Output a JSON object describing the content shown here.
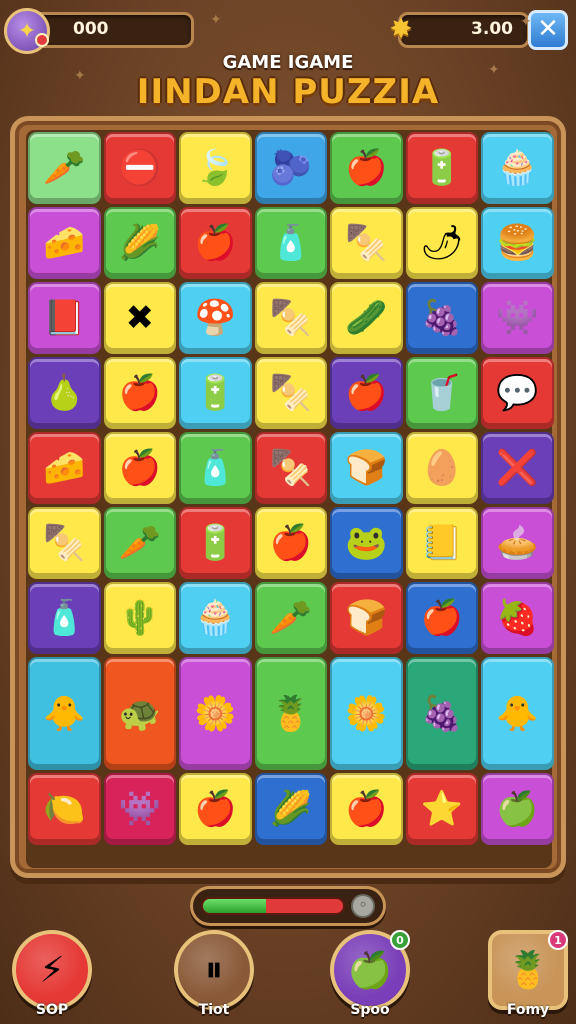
{
  "hud": {
    "score": "000",
    "coins": "3.00",
    "avatar_icon": "wand-icon",
    "coin_icon": "star-coin-icon",
    "close_icon": "close-icon"
  },
  "title": {
    "top": "GAME IGAME",
    "main": "IINDAN PUZZIA"
  },
  "board": {
    "columns": 7,
    "rows": [
      {
        "tiles": [
          {
            "color": "#8de08a",
            "icon": "🥕",
            "name": "carrot-tile"
          },
          {
            "color": "#e53935",
            "icon": "⛔",
            "name": "ball-tile"
          },
          {
            "color": "#ffe84a",
            "icon": "🍃",
            "name": "leaf-tile"
          },
          {
            "color": "#3fa6e8",
            "icon": "🫐",
            "name": "berry-tile"
          },
          {
            "color": "#5ec94f",
            "icon": "🍎",
            "name": "apple-tile"
          },
          {
            "color": "#e53935",
            "icon": "🔋",
            "name": "battery-tile"
          },
          {
            "color": "#4fd0f2",
            "icon": "🧁",
            "name": "cupcake-tile"
          }
        ]
      },
      {
        "tiles": [
          {
            "color": "#c94fd6",
            "icon": "🧀",
            "name": "cheese-tile"
          },
          {
            "color": "#5ec94f",
            "icon": "🌽",
            "name": "corn-tile"
          },
          {
            "color": "#e53935",
            "icon": "🍎",
            "name": "apple-tile"
          },
          {
            "color": "#5ec94f",
            "icon": "🧴",
            "name": "bottle-tile"
          },
          {
            "color": "#ffe84a",
            "icon": "🍢",
            "name": "skewer-tile"
          },
          {
            "color": "#ffe84a",
            "icon": "🌶",
            "name": "pepper-tile"
          },
          {
            "color": "#4fd0f2",
            "icon": "🍔",
            "name": "burger-tile"
          }
        ]
      },
      {
        "tiles": [
          {
            "color": "#c94fd6",
            "icon": "📕",
            "name": "book-tile"
          },
          {
            "color": "#ffe84a",
            "icon": "✖",
            "name": "cross-tile"
          },
          {
            "color": "#4fd0f2",
            "icon": "🍄",
            "name": "mushroom-tile"
          },
          {
            "color": "#ffe84a",
            "icon": "🍢",
            "name": "skewer-tile"
          },
          {
            "color": "#ffe84a",
            "icon": "🥒",
            "name": "cucumber-tile"
          },
          {
            "color": "#2f6fd0",
            "icon": "🍇",
            "name": "grape-tile"
          },
          {
            "color": "#c94fd6",
            "icon": "👾",
            "name": "monster-tile"
          }
        ]
      },
      {
        "tiles": [
          {
            "color": "#6a3fb8",
            "icon": "🍐",
            "name": "pear-tile"
          },
          {
            "color": "#ffe84a",
            "icon": "🍎",
            "name": "apple-tile"
          },
          {
            "color": "#4fd0f2",
            "icon": "🔋",
            "name": "battery-tile"
          },
          {
            "color": "#ffe84a",
            "icon": "🍢",
            "name": "skewer-tile"
          },
          {
            "color": "#6a3fb8",
            "icon": "🍎",
            "name": "apple-tile"
          },
          {
            "color": "#5ec94f",
            "icon": "🥤",
            "name": "cup-tile"
          },
          {
            "color": "#e53935",
            "icon": "💬",
            "name": "bubble-tile"
          }
        ]
      },
      {
        "tiles": [
          {
            "color": "#e53935",
            "icon": "🧀",
            "name": "cheese-tile"
          },
          {
            "color": "#ffe84a",
            "icon": "🍎",
            "name": "apple-tile"
          },
          {
            "color": "#5ec94f",
            "icon": "🧴",
            "name": "bottle-tile"
          },
          {
            "color": "#e53935",
            "icon": "🍢",
            "name": "skewer-tile"
          },
          {
            "color": "#4fd0f2",
            "icon": "🍞",
            "name": "bread-tile"
          },
          {
            "color": "#ffe84a",
            "icon": "🥚",
            "name": "egg-tile"
          },
          {
            "color": "#6a3fb8",
            "icon": "❌",
            "name": "cross-tile"
          }
        ]
      },
      {
        "tiles": [
          {
            "color": "#ffe84a",
            "icon": "🍢",
            "name": "skewer-tile"
          },
          {
            "color": "#5ec94f",
            "icon": "🥕",
            "name": "carrot-tile"
          },
          {
            "color": "#e53935",
            "icon": "🔋",
            "name": "battery-tile"
          },
          {
            "color": "#ffe84a",
            "icon": "🍎",
            "name": "apple-tile"
          },
          {
            "color": "#2f6fd0",
            "icon": "🐸",
            "name": "frog-tile"
          },
          {
            "color": "#ffe84a",
            "icon": "📒",
            "name": "note-tile"
          },
          {
            "color": "#c94fd6",
            "icon": "🥧",
            "name": "pie-tile"
          }
        ]
      },
      {
        "tiles": [
          {
            "color": "#6a3fb8",
            "icon": "🧴",
            "name": "bottle-tile"
          },
          {
            "color": "#ffe84a",
            "icon": "🌵",
            "name": "cactus-tile"
          },
          {
            "color": "#4fd0f2",
            "icon": "🧁",
            "name": "cupcake-tile"
          },
          {
            "color": "#5ec94f",
            "icon": "🥕",
            "name": "carrot-tile"
          },
          {
            "color": "#e53935",
            "icon": "🍞",
            "name": "bread-tile"
          },
          {
            "color": "#2f6fd0",
            "icon": "🍎",
            "name": "apple-tile"
          },
          {
            "color": "#c94fd6",
            "icon": "🍓",
            "name": "berry-tile"
          }
        ]
      },
      {
        "tiles": [
          {
            "color": "#3fc0e0",
            "icon": "🐥",
            "name": "chick-tile"
          },
          {
            "color": "#f0561f",
            "icon": "🐢",
            "name": "turtle-tile"
          },
          {
            "color": "#c94fd6",
            "icon": "🌼",
            "name": "flower-tile"
          },
          {
            "color": "#5ec94f",
            "icon": "🍍",
            "name": "pineapple-tile"
          },
          {
            "color": "#4fd0f2",
            "icon": "🌼",
            "name": "flower-tile"
          },
          {
            "color": "#2aa87a",
            "icon": "🍇",
            "name": "grape-tile"
          },
          {
            "color": "#4fd0f2",
            "icon": "🐥",
            "name": "chick-tile"
          }
        ]
      },
      {
        "tiles": [
          {
            "color": "#e53935",
            "icon": "🍋",
            "name": "lemon-tile"
          },
          {
            "color": "#d8235a",
            "icon": "👾",
            "name": "monster-tile"
          },
          {
            "color": "#ffe84a",
            "icon": "🍎",
            "name": "apple-tile"
          },
          {
            "color": "#2f6fd0",
            "icon": "🌽",
            "name": "corn-tile"
          },
          {
            "color": "#ffe84a",
            "icon": "🍎",
            "name": "apple-tile"
          },
          {
            "color": "#e53935",
            "icon": "⭐",
            "name": "star-tile"
          },
          {
            "color": "#c94fd6",
            "icon": "🍏",
            "name": "green-apple-tile"
          }
        ]
      }
    ]
  },
  "progress": {
    "fraction": 0.45,
    "knob_icon": "settings-knob-icon"
  },
  "buttons": [
    {
      "label": "SOP",
      "icon": "⚡",
      "icon_name": "lightning-icon",
      "color": "#e53935",
      "badge": ""
    },
    {
      "label": "Tiot",
      "icon": "⏸",
      "icon_name": "pause-icon",
      "color": "#8a5a38",
      "badge": ""
    },
    {
      "label": "Spoo",
      "icon": "🍏",
      "icon_name": "apple-icon",
      "color": "#7a3fb8",
      "badge": "0"
    },
    {
      "label": "Fomy",
      "icon": "🍍",
      "icon_name": "pineapple-icon",
      "color": "#c89458",
      "badge": "1"
    }
  ]
}
